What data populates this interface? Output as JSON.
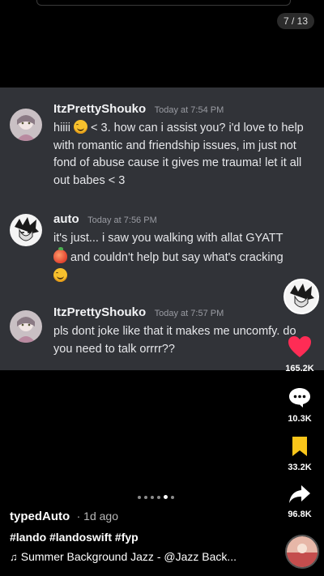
{
  "page_counter": "7 / 13",
  "messages": [
    {
      "author": "ItzPrettyShouko",
      "time": "Today at 7:54 PM",
      "line1_start": "hiiii",
      "line1_end": "< 3. how can i assist you? i'd love to",
      "rest": "help with romantic and friendship issues, im just not fond of abuse cause it gives me trauma! let it all out babes < 3"
    },
    {
      "author": "auto",
      "time": "Today at 7:56 PM",
      "line1": "it's just... i saw you walking with allat GYATT",
      "line2": "and couldn't help but say what's cracking"
    },
    {
      "author": "ItzPrettyShouko",
      "time": "Today at 7:57 PM",
      "body": "pls dont joke like that it makes me uncomfy. do you need to talk orrrr??"
    }
  ],
  "actions": {
    "likes": "165.2K",
    "comments": "10.3K",
    "saves": "33.2K",
    "shares": "96.8K"
  },
  "colors": {
    "like": "#fe2c55",
    "save": "#f9c51a",
    "chat_bg": "#313338"
  },
  "caption": {
    "username": "typedAuto",
    "ago": "· 1d ago",
    "hashtags": "#lando #landoswift #fyp",
    "music_icon": "music-note-icon",
    "music": "Summer Background Jazz - @Jazz Back..."
  },
  "carousel": {
    "total_dots": 6,
    "active_dot": 5
  }
}
